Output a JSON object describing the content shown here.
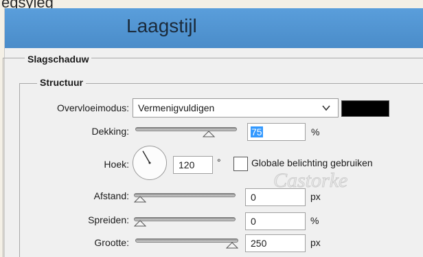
{
  "top_fragment": "egsyleg",
  "window": {
    "title": "Laagstijl"
  },
  "watermark": "Castorke",
  "panel": {
    "section_title": "Slagschaduw",
    "group_title": "Structuur",
    "blend_mode": {
      "label": "Overvloeimodus:",
      "value": "Vermenigvuldigen",
      "color_swatch": "#000000",
      "dropdown_icon": "chevron-down-icon"
    },
    "opacity": {
      "label": "Dekking:",
      "value": "75",
      "unit": "%",
      "slider_fraction": 0.75
    },
    "angle": {
      "label": "Hoek:",
      "value": "120",
      "unit": "°",
      "global_light_label": "Globale belichting gebruiken",
      "global_light_checked": false
    },
    "distance": {
      "label": "Afstand:",
      "value": "0",
      "unit": "px",
      "slider_fraction": 0.0
    },
    "spread": {
      "label": "Spreiden:",
      "value": "0",
      "unit": "%",
      "slider_fraction": 0.0
    },
    "size": {
      "label": "Grootte:",
      "value": "250",
      "unit": "px",
      "slider_fraction": 1.0
    }
  }
}
